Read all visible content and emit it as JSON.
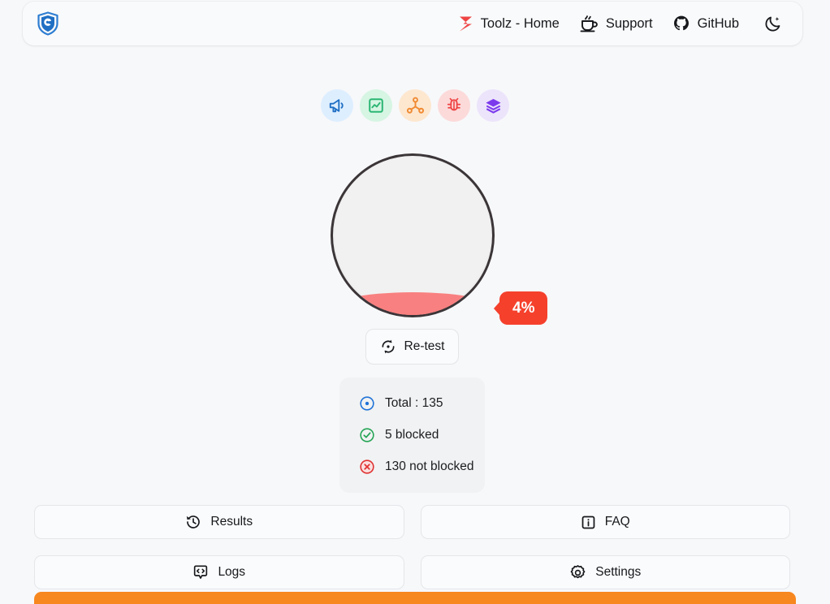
{
  "header": {
    "brand": {
      "icon": "shield-logo-icon",
      "color": "#1f6fc4"
    },
    "nav": [
      {
        "label": "Toolz - Home",
        "icon": "toolz-z-logo-icon",
        "color": "#ef4444"
      },
      {
        "label": "Support",
        "icon": "coffee-cup-icon",
        "color": "#16181c"
      },
      {
        "label": "GitHub",
        "icon": "github-icon",
        "color": "#16181c"
      }
    ],
    "theme_toggle": {
      "icon": "moon-star-icon",
      "label": ""
    }
  },
  "features": [
    {
      "name": "ads",
      "icon": "megaphone-icon",
      "color": "#1f6fc4",
      "bg": "#ddeeff"
    },
    {
      "name": "analytics",
      "icon": "chart-frame-icon",
      "color": "#2bb673",
      "bg": "#d6f5e3"
    },
    {
      "name": "trackers",
      "icon": "network-nodes-icon",
      "color": "#f08a32",
      "bg": "#fde7cf"
    },
    {
      "name": "malware",
      "icon": "bug-icon",
      "color": "#ef4444",
      "bg": "#fcdada"
    },
    {
      "name": "other",
      "icon": "layers-icon",
      "color": "#7c3aed",
      "bg": "#ece4fb"
    }
  ],
  "gauge": {
    "percent_label": "4%",
    "fill_percent": 4,
    "fill_color": "#f98080",
    "badge_color": "#f5402c"
  },
  "retest": {
    "label": "Re-test",
    "icon": "refresh-dot-icon"
  },
  "stats": [
    {
      "icon": "circle-dot-icon",
      "color": "#1f72d8",
      "label": "Total : 135"
    },
    {
      "icon": "check-circle-icon",
      "color": "#23a455",
      "label": "5 blocked"
    },
    {
      "icon": "x-circle-icon",
      "color": "#e03131",
      "label": "130 not blocked"
    }
  ],
  "actions": [
    {
      "label": "Results",
      "icon": "history-clock-icon"
    },
    {
      "label": "FAQ",
      "icon": "info-square-icon"
    },
    {
      "label": "Logs",
      "icon": "code-bubble-icon"
    },
    {
      "label": "Settings",
      "icon": "gear-icon"
    }
  ],
  "bottom_bar": {
    "color": "#f7871f"
  }
}
